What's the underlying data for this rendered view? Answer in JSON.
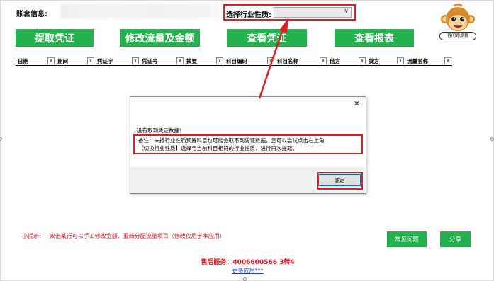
{
  "account": {
    "label": "账套信息:"
  },
  "industry": {
    "label": "选择行业性质:",
    "selected": ""
  },
  "buttons": {
    "extract": "提取凭证",
    "modify": "修改流量及金额",
    "view_voucher": "查看凭证",
    "view_report": "查看报表"
  },
  "mascot": {
    "caption": "有问题点我"
  },
  "columns": [
    "日期",
    "期间",
    "凭证字",
    "凭证号",
    "摘要",
    "科目编码",
    "科目名称",
    "借方",
    "贷方",
    "流量名称"
  ],
  "dialog": {
    "close": "✕",
    "message": "没有取到凭证数据！",
    "note_line1": "备注：未按行业性质预置科目也可能会取不到凭证数据，您可以尝试点击右上角",
    "note_line2": "【切换行业性质】选择与当前科目相符的行业性质，进行再次提取。",
    "ok": "确定"
  },
  "tip": {
    "label": "小提示:",
    "text": "双击某行可以手工修改金额、重新分配流量项目（修改仅用于本应用）"
  },
  "footer_buttons": {
    "faq": "常见问题",
    "share": "分享"
  },
  "service": "售后服务：4006600566 3转4",
  "more_apps": "更多应用***",
  "colors": {
    "green": "#22b14c",
    "red": "#e51b24",
    "link": "#1f3fbf"
  }
}
